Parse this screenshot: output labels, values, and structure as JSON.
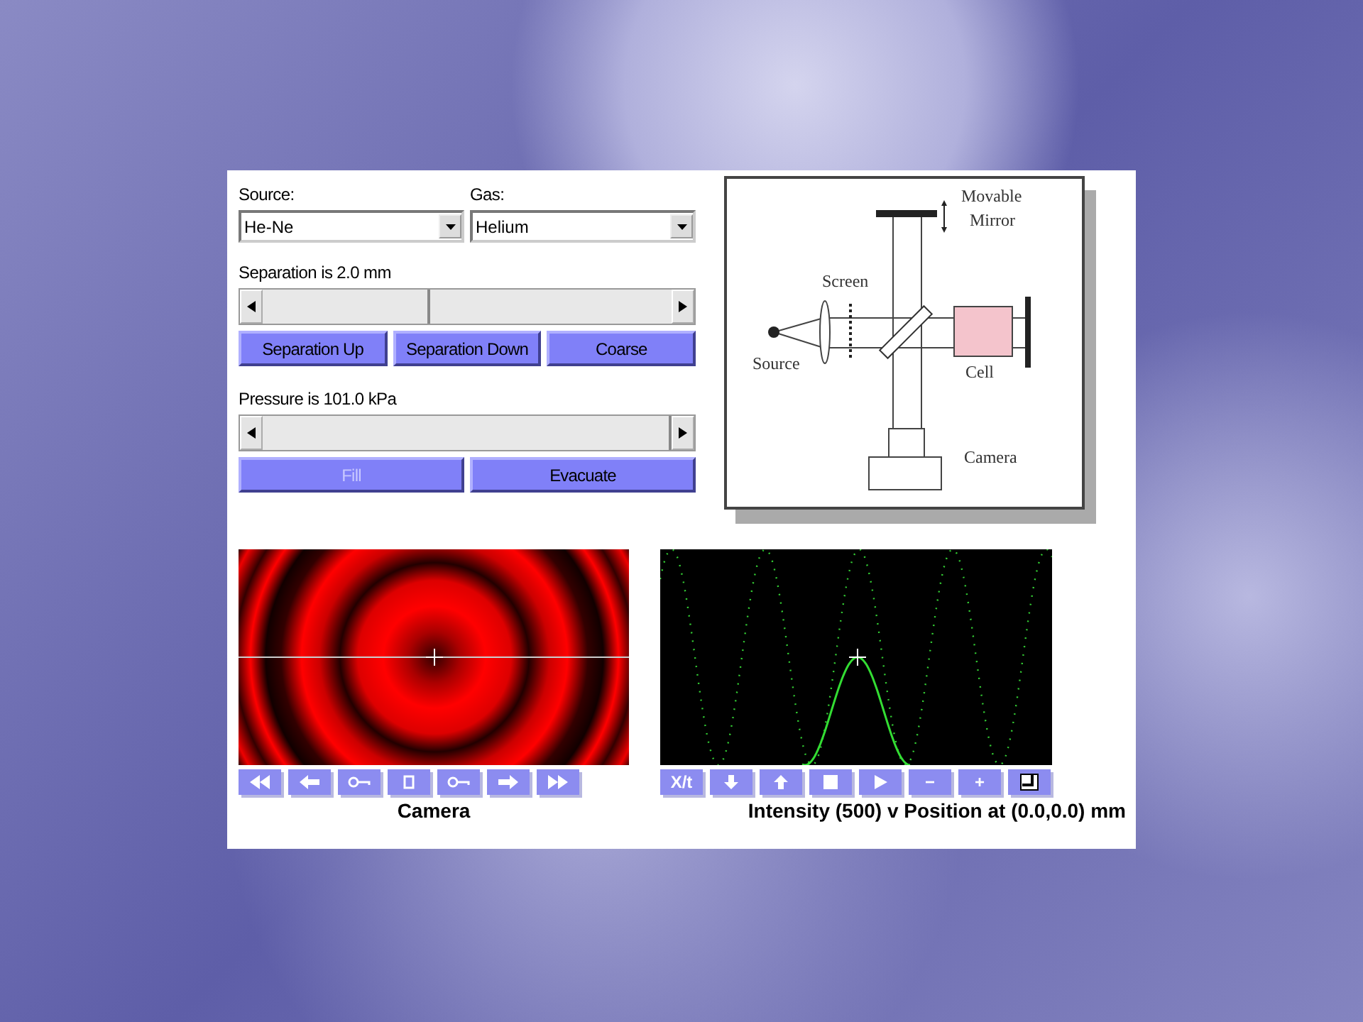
{
  "source": {
    "label": "Source:",
    "value": "He-Ne"
  },
  "gas": {
    "label": "Gas:",
    "value": "Helium"
  },
  "separation": {
    "label": "Separation is 2.0 mm",
    "level": 0.41
  },
  "separation_buttons": [
    {
      "label": "Separation Up",
      "disabled": false
    },
    {
      "label": "Separation Down",
      "disabled": false
    },
    {
      "label": "Coarse",
      "disabled": false
    }
  ],
  "pressure": {
    "label": "Pressure is 101.0 kPa",
    "level": 1
  },
  "pressure_buttons": [
    {
      "label": "Fill",
      "disabled": true
    },
    {
      "label": "Evacuate",
      "disabled": false
    }
  ],
  "diagram": {
    "labels": [
      {
        "kind": "mirror",
        "lines": [
          "Movable",
          "Mirror"
        ]
      },
      {
        "kind": "screen",
        "lines": [
          "Screen"
        ]
      },
      {
        "kind": "source",
        "lines": [
          "Source"
        ]
      },
      {
        "kind": "cell",
        "lines": [
          "Cell"
        ]
      },
      {
        "kind": "camera",
        "lines": [
          "Camera"
        ]
      }
    ]
  },
  "camera": {
    "caption": "Camera",
    "toolbar": [
      {
        "kind": "rewind"
      },
      {
        "kind": "left"
      },
      {
        "kind": "key"
      },
      {
        "kind": "stop"
      },
      {
        "kind": "key2"
      },
      {
        "kind": "right"
      },
      {
        "kind": "forward"
      }
    ]
  },
  "plot": {
    "caption": "Intensity (500) v Position at (0.0,0.0) mm",
    "toolbar": [
      {
        "kind": "text",
        "text": "X/t"
      },
      {
        "kind": "down"
      },
      {
        "kind": "up"
      },
      {
        "kind": "square"
      },
      {
        "kind": "play"
      },
      {
        "kind": "text",
        "text": "−"
      },
      {
        "kind": "text",
        "text": "+"
      },
      {
        "kind": "corner"
      }
    ]
  }
}
